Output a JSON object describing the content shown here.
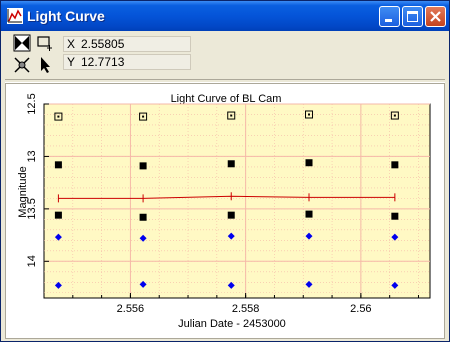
{
  "window": {
    "title": "Light Curve",
    "icon": "chart-icon"
  },
  "titlebar_buttons": [
    "minimize-icon",
    "maximize-icon",
    "close-icon"
  ],
  "toolbar": {
    "tools": [
      "zoom-reset-icon",
      "zoom-box-icon",
      "pan-icon",
      "pointer-icon"
    ],
    "x_label": "X",
    "x_value": "2.55805",
    "y_label": "Y",
    "y_value": "12.7713"
  },
  "chart_data": {
    "type": "scatter",
    "title": "Light Curve of BL Cam",
    "xlabel": "Julian Date - 2453000",
    "ylabel": "Magnitude",
    "xlim": [
      2.5545,
      2.5612
    ],
    "ylim": [
      12.5,
      14.35
    ],
    "y_inverted": true,
    "xticks": [
      "2.556",
      "2.558",
      "2.56"
    ],
    "xtick_values": [
      2.556,
      2.558,
      2.56
    ],
    "yticks": [
      "12.5",
      "13",
      "13.5",
      "14"
    ],
    "ytick_values": [
      12.5,
      13,
      13.5,
      14
    ],
    "grid": true,
    "background": "#fff9c4",
    "grid_color": "#f5b8a8",
    "series": [
      {
        "marker": "hollow-square",
        "color": "#000000",
        "x": [
          2.55475,
          2.55622,
          2.55775,
          2.5591,
          2.56059
        ],
        "y": [
          12.62,
          12.62,
          12.61,
          12.6,
          12.61
        ]
      },
      {
        "marker": "filled-square",
        "color": "#000000",
        "x": [
          2.55475,
          2.55622,
          2.55775,
          2.5591,
          2.56059
        ],
        "y": [
          13.08,
          13.09,
          13.07,
          13.06,
          13.08
        ]
      },
      {
        "marker": "filled-square",
        "color": "#000000",
        "x": [
          2.55475,
          2.55622,
          2.55775,
          2.5591,
          2.56059
        ],
        "y": [
          13.56,
          13.58,
          13.56,
          13.55,
          13.57
        ]
      },
      {
        "marker": "line-errorbar",
        "color": "#cc0000",
        "x": [
          2.55475,
          2.55622,
          2.55775,
          2.5591,
          2.56059
        ],
        "y": [
          13.4,
          13.4,
          13.38,
          13.39,
          13.39
        ]
      },
      {
        "marker": "diamond",
        "color": "#0000ee",
        "x": [
          2.55475,
          2.55622,
          2.55775,
          2.5591,
          2.56059
        ],
        "y": [
          13.77,
          13.78,
          13.76,
          13.76,
          13.77
        ]
      },
      {
        "marker": "diamond",
        "color": "#0000ee",
        "x": [
          2.55475,
          2.55622,
          2.55775,
          2.5591,
          2.56059
        ],
        "y": [
          14.23,
          14.22,
          14.23,
          14.22,
          14.23
        ]
      }
    ]
  }
}
